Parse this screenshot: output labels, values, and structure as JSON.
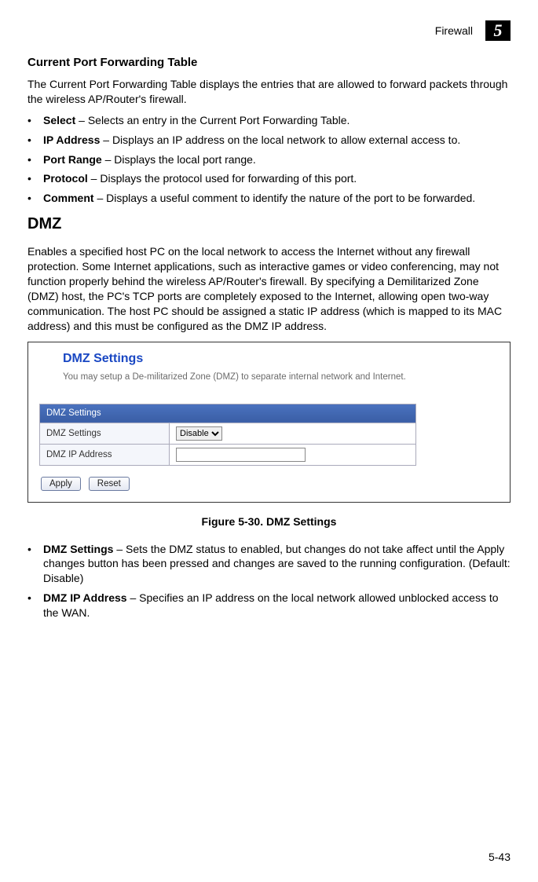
{
  "header": {
    "section": "Firewall",
    "chapter": "5"
  },
  "pft": {
    "heading": "Current Port Forwarding Table",
    "intro": "The Current Port Forwarding Table displays the entries that are allowed to forward packets through the wireless AP/Router's firewall.",
    "items": [
      {
        "term": "Select",
        "desc": " – Selects an entry in the Current Port Forwarding Table."
      },
      {
        "term": "IP Address",
        "desc": " – Displays an IP address on the local network to allow external access to."
      },
      {
        "term": "Port Range",
        "desc": " – Displays the local port range."
      },
      {
        "term": "Protocol",
        "desc": " – Displays the protocol used for forwarding of this port."
      },
      {
        "term": "Comment",
        "desc": " – Displays a useful comment to identify the nature of the port to be forwarded."
      }
    ]
  },
  "dmz": {
    "heading": "DMZ",
    "intro": "Enables a specified host PC on the local network to access the Internet without any firewall protection. Some Internet applications, such as interactive games or video conferencing, may not function properly behind the wireless AP/Router's firewall. By specifying a Demilitarized Zone (DMZ) host, the PC's TCP ports are completely exposed to the Internet, allowing open two-way communication. The host PC should be assigned a static IP address (which is mapped to its MAC address) and this must be configured as the DMZ IP address.",
    "figure": {
      "title": "DMZ Settings",
      "sub": "You may setup a De-militarized Zone (DMZ) to separate internal network and Internet.",
      "table_header": "DMZ Settings",
      "row1_label": "DMZ Settings",
      "row1_value": "Disable",
      "row2_label": "DMZ IP Address",
      "row2_value": "",
      "apply": "Apply",
      "reset": "Reset",
      "caption": "Figure 5-30.   DMZ Settings"
    },
    "items": [
      {
        "term": "DMZ Settings",
        "desc": " – Sets the DMZ status to enabled, but changes do not take affect until the Apply changes button has been pressed and changes are saved to the running configuration. (Default: Disable)"
      },
      {
        "term": "DMZ IP Address",
        "desc": " – Specifies an IP address on the local network allowed unblocked access to the WAN."
      }
    ]
  },
  "footer": {
    "page": "5-43"
  }
}
